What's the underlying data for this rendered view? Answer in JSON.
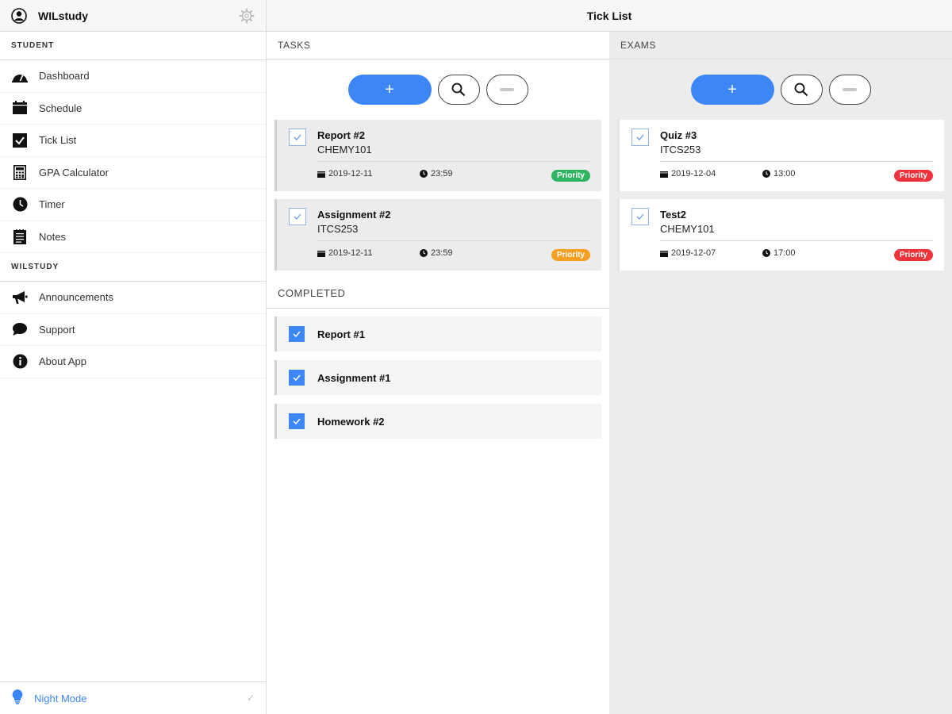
{
  "app": {
    "name": "WILstudy",
    "page_title": "Tick List"
  },
  "sidebar": {
    "section_student": "STUDENT",
    "student_items": [
      {
        "label": "Dashboard",
        "icon": "dashboard-icon"
      },
      {
        "label": "Schedule",
        "icon": "schedule-icon"
      },
      {
        "label": "Tick List",
        "icon": "checkbox-icon"
      },
      {
        "label": "GPA Calculator",
        "icon": "calculator-icon"
      },
      {
        "label": "Timer",
        "icon": "clock-icon"
      },
      {
        "label": "Notes",
        "icon": "notes-icon"
      }
    ],
    "section_wilstudy": "WILSTUDY",
    "wil_items": [
      {
        "label": "Announcements",
        "icon": "megaphone-icon"
      },
      {
        "label": "Support",
        "icon": "chat-bubble-icon"
      },
      {
        "label": "About App",
        "icon": "info-icon"
      }
    ],
    "night_mode": {
      "label": "Night Mode",
      "icon": "lightbulb-icon",
      "accent": "#3b86f7"
    }
  },
  "tasks": {
    "heading": "TASKS",
    "buttons": {
      "add": "+"
    },
    "items": [
      {
        "title": "Report #2",
        "course": "CHEMY101",
        "date": "2019-12-11",
        "time": "23:59",
        "priority": "Priority",
        "priority_color": "#2fb561"
      },
      {
        "title": "Assignment #2",
        "course": "ITCS253",
        "date": "2019-12-11",
        "time": "23:59",
        "priority": "Priority",
        "priority_color": "#f5a023"
      }
    ],
    "completed_heading": "COMPLETED",
    "completed": [
      {
        "title": "Report #1"
      },
      {
        "title": "Assignment #1"
      },
      {
        "title": "Homework #2"
      }
    ]
  },
  "exams": {
    "heading": "EXAMS",
    "buttons": {
      "add": "+"
    },
    "items": [
      {
        "title": "Quiz #3",
        "course": "ITCS253",
        "date": "2019-12-04",
        "time": "13:00",
        "priority": "Priority",
        "priority_color": "#f0333b"
      },
      {
        "title": "Test2",
        "course": "CHEMY101",
        "date": "2019-12-07",
        "time": "17:00",
        "priority": "Priority",
        "priority_color": "#f0333b"
      }
    ]
  },
  "colors": {
    "accent": "#3d86f5"
  }
}
